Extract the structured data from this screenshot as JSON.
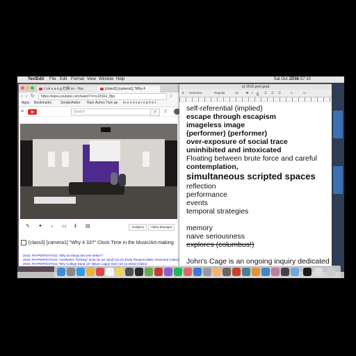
{
  "menubar": {
    "apple": "",
    "app_name": "TextEdit",
    "menus": [
      "File",
      "Edit",
      "Format",
      "View",
      "Window",
      "Help"
    ],
    "status_clock": "Sat Oct 22  15:57:10",
    "battery": "73%"
  },
  "browser": {
    "tabs": [
      "t i m s a n g 打网 co - You",
      "[class3] [camera1] \"Why 4",
      ""
    ],
    "url": "https://www.youtube.com/watch?v=oJ3SFe_fbjo",
    "bookmarks": [
      "Apps",
      "Bookmarks",
      "SimpleAdder",
      "Rare Ashes Twin ge",
      "m o n s v p r o p h e t"
    ],
    "search_placeholder": "Search",
    "video_buttons": [
      "Analytics",
      "Video Manager"
    ],
    "video_title": "[class3] [camera1] \"Why 4 33?\" Clock Time in the Music/Art-making",
    "links": [
      "2015: #HYPERTEXTS21 \"Why do things become better?\"",
      "2015: #HYPERTEXTS21 \"Aesthetics Thinking\" (lulu) (Sr.art Jand) (10.22.2016) #SuperCollider #avicrand (Video)",
      "2015: #HYPERTEXTS21 \"Nhv College Dand Us\" (Blues Lague Sier) (10.14.2016) (Video)"
    ]
  },
  "textedit": {
    "title": "zz 2016 post grad",
    "toolbar": [
      "Helvetica",
      "Regular",
      "12"
    ],
    "lines": [
      {
        "text": "self-referential (implied)",
        "style": "normal"
      },
      {
        "text": "escape through escapism",
        "style": "bold"
      },
      {
        "text": "imageless image",
        "style": "bold"
      },
      {
        "text": "(performer) (performer)",
        "style": "bold"
      },
      {
        "text": "over-exposure of social trace",
        "style": "bold"
      },
      {
        "text": "uninhibited and intoxicated",
        "style": "bold"
      },
      {
        "text": "Floating between brute force and careful",
        "style": "normal"
      },
      {
        "text": "contemplation,",
        "style": "bold-partial"
      },
      {
        "text": "simultaneous scripted spaces",
        "style": "big"
      },
      {
        "text": "reflection",
        "style": "normal"
      },
      {
        "text": "performance",
        "style": "normal"
      },
      {
        "text": "events",
        "style": "normal"
      },
      {
        "text": "temporal strategies",
        "style": "normal"
      },
      {
        "text": "",
        "style": "normal"
      },
      {
        "text": "memory",
        "style": "normal"
      },
      {
        "text": "naive seriousness",
        "style": "normal"
      },
      {
        "text": "explores  (columbus!)",
        "style": "strike"
      },
      {
        "text": "",
        "style": "normal"
      },
      {
        "text": "John's Cage is an ongoing inquiry dedicated",
        "style": "normal"
      }
    ]
  },
  "colors": {
    "youtube_red": "#e52d27",
    "desktop": "#5a4a55",
    "link": "#2020c0"
  }
}
